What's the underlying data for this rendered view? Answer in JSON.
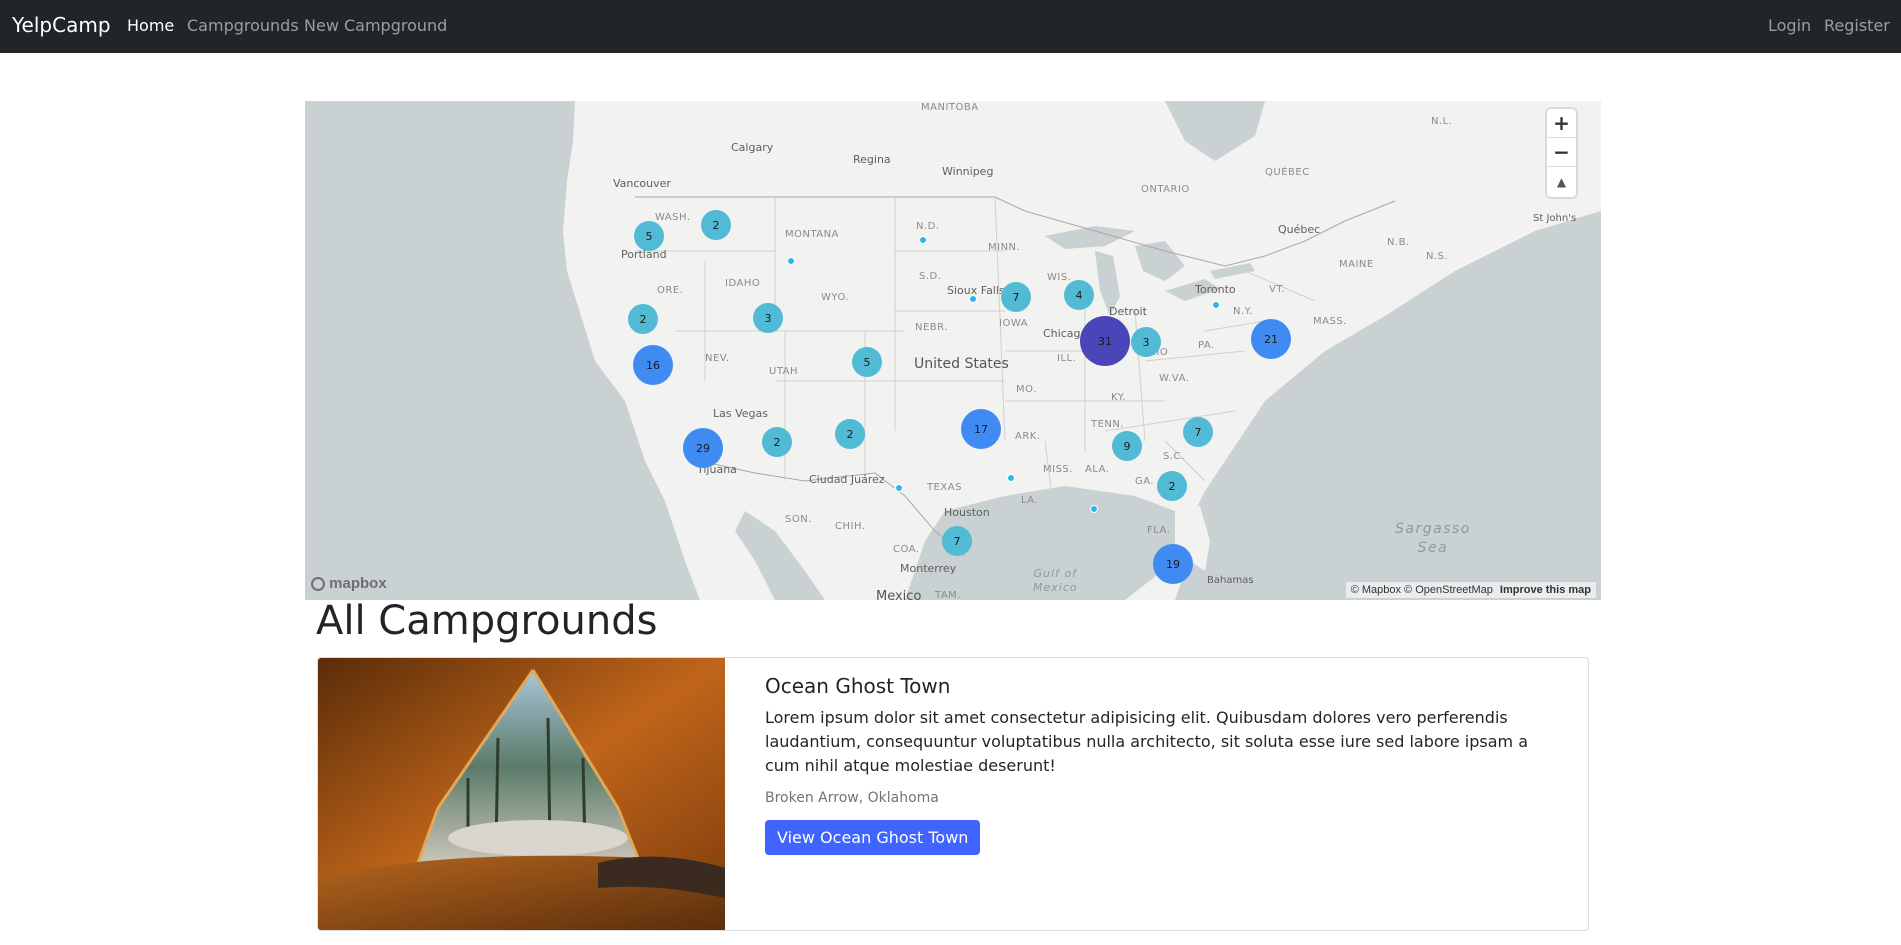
{
  "navbar": {
    "brand": "YelpCamp",
    "links": [
      "Home",
      "Campgrounds",
      "New Campground"
    ],
    "auth": [
      "Login",
      "Register"
    ]
  },
  "map": {
    "labels": {
      "manitoba": "MANITOBA",
      "ontario": "ONTARIO",
      "quebec_prov": "QUÉBEC",
      "nl": "N.L.",
      "calgary": "Calgary",
      "regina": "Regina",
      "winnipeg": "Winnipeg",
      "vancouver": "Vancouver",
      "quebec_city": "Québec",
      "st_johns": "St John's",
      "wash": "WASH.",
      "montana": "MONTANA",
      "nd": "N.D.",
      "minn": "MINN.",
      "maine": "MAINE",
      "nb": "N.B.",
      "ns": "N.S.",
      "portland": "Portland",
      "ore": "ORE.",
      "idaho": "IDAHO",
      "wyo": "WYO.",
      "sd": "S.D.",
      "sioux_falls": "Sioux Falls",
      "wis": "WIS.",
      "toronto": "Toronto",
      "vt": "VT.",
      "detroit": "Detroit",
      "ny": "N.Y.",
      "nebr": "NEBR.",
      "iowa": "IOWA",
      "chicago": "Chicago",
      "mass": "MASS.",
      "nev": "NEV.",
      "united_states": "United States",
      "ill": "ILL.",
      "ohio": "OHIO",
      "pa": "PA.",
      "utah": "UTAH",
      "mo": "MO.",
      "wva": "W.VA.",
      "ky": "KY.",
      "las_vegas": "Las Vegas",
      "tenn": "TENN.",
      "ark": "ARK.",
      "sc": "S.C.",
      "tijuana": "Tijuana",
      "ciudad_juarez": "Ciudad Juárez",
      "texas": "TEXAS",
      "miss": "MISS.",
      "ala": "ALA.",
      "ga": "GA.",
      "la": "LA.",
      "son": "SON.",
      "chih": "CHIH.",
      "houston": "Houston",
      "fla": "FLA.",
      "coa": "COA.",
      "monterrey": "Monterrey",
      "bahamas": "Bahamas",
      "mexico": "Mexico",
      "tam": "TAM.",
      "sargasso_sea": "Sargasso\nSea",
      "gulf_of_mexico": "Gulf of\nMexico"
    },
    "clusters": [
      "5",
      "2",
      "2",
      "3",
      "16",
      "29",
      "2",
      "5",
      "2",
      "17",
      "7",
      "4",
      "31",
      "3",
      "21",
      "7",
      "9",
      "2",
      "7",
      "19"
    ],
    "controls": {
      "zoom_in": "+",
      "zoom_out": "−",
      "compass": "▲"
    },
    "attribution": "© Mapbox © OpenStreetMap",
    "improve": "Improve this map",
    "logo": "mapbox"
  },
  "page": {
    "heading": "All Campgrounds"
  },
  "campgrounds": [
    {
      "title": "Ocean Ghost Town",
      "description": "Lorem ipsum dolor sit amet consectetur adipisicing elit. Quibusdam dolores vero perferendis laudantium, consequuntur voluptatibus nulla architecto, sit soluta esse iure sed labore ipsam a cum nihil atque molestiae deserunt!",
      "location": "Broken Arrow, Oklahoma",
      "button": "View Ocean Ghost Town"
    }
  ],
  "colors": {
    "navbar_bg": "#212529",
    "cluster_small": "#51bbd6",
    "cluster_medium": "#3f8bf2",
    "cluster_large": "#4a45b8",
    "button": "#3f64ff"
  }
}
